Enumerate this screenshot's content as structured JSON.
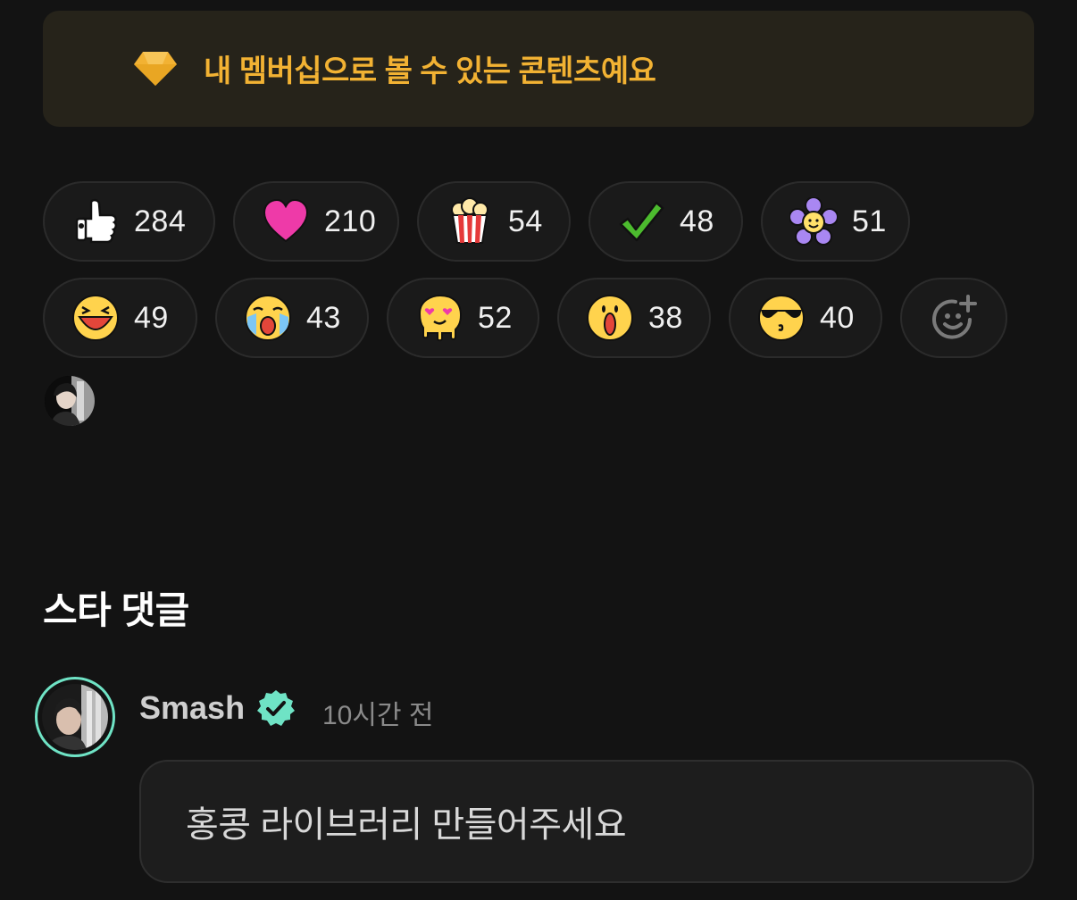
{
  "banner": {
    "text": "내 멤버십으로 볼 수 있는 콘텐츠예요",
    "icon": "diamond-icon",
    "color": "#f2b233"
  },
  "reactions": [
    {
      "icon": "thumbs-up-icon",
      "count": "284"
    },
    {
      "icon": "heart-icon",
      "count": "210"
    },
    {
      "icon": "popcorn-icon",
      "count": "54"
    },
    {
      "icon": "checkmark-icon",
      "count": "48"
    },
    {
      "icon": "flower-icon",
      "count": "51"
    },
    {
      "icon": "laughing-face-icon",
      "count": "49"
    },
    {
      "icon": "crying-face-icon",
      "count": "43"
    },
    {
      "icon": "melting-heart-eyes-icon",
      "count": "52"
    },
    {
      "icon": "shocked-face-icon",
      "count": "38"
    },
    {
      "icon": "sunglasses-face-icon",
      "count": "40"
    }
  ],
  "add_reaction_icon": "add-emoji-icon",
  "section_title": "스타 댓글",
  "comment": {
    "author": "Smash",
    "verified_icon": "verified-badge-icon",
    "time": "10시간 전",
    "text": "홍콩 라이브러리 만들어주세요",
    "ring_color": "#6fe3c5"
  }
}
